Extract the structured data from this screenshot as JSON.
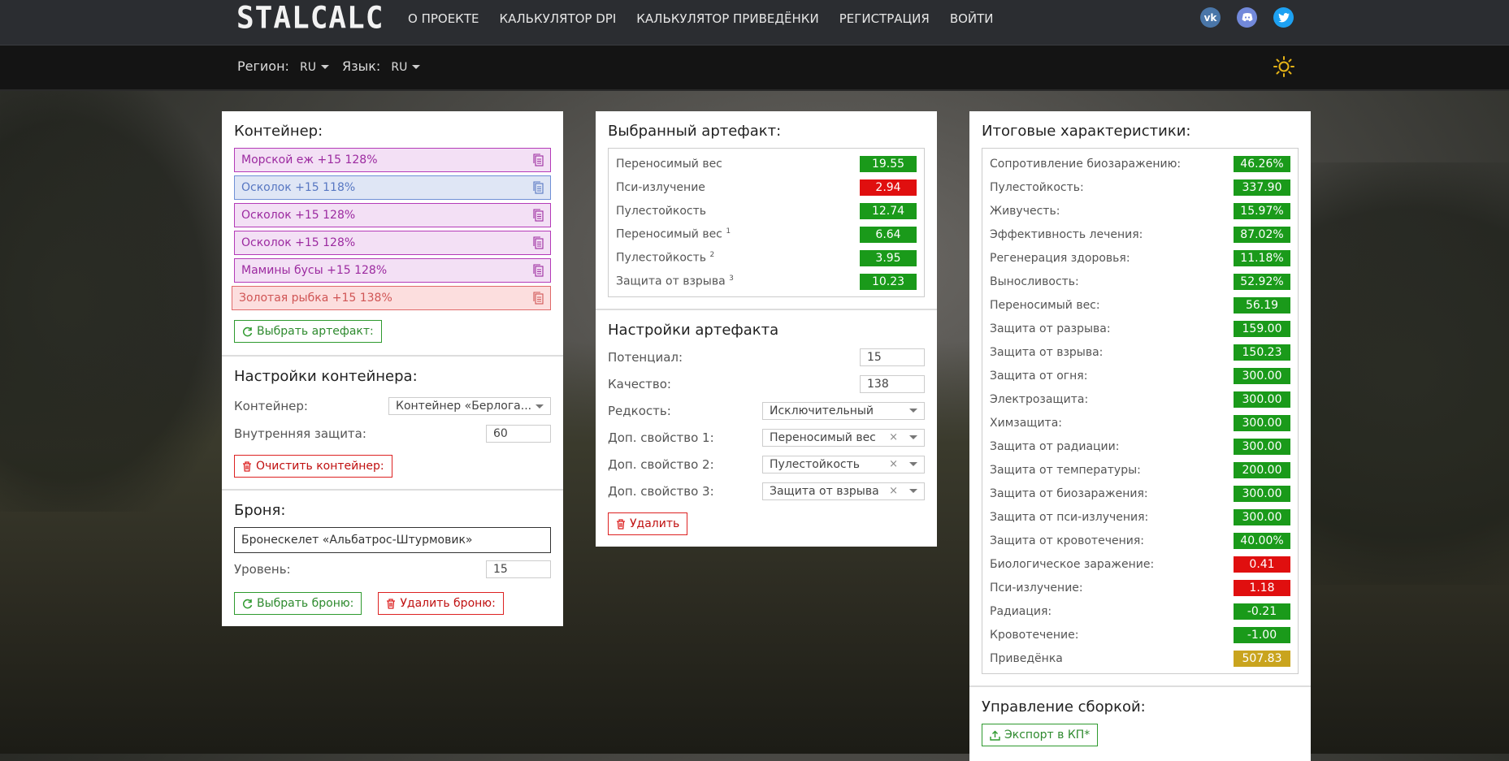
{
  "header": {
    "logo": "STALCALC",
    "nav": [
      "О ПРОЕКТЕ",
      "КАЛЬКУЛЯТОР DPI",
      "КАЛЬКУЛЯТОР ПРИВЕДЁНКИ",
      "РЕГИСТРАЦИЯ",
      "ВОЙТИ"
    ],
    "social": [
      "vk-icon",
      "discord-icon",
      "twitter-icon"
    ]
  },
  "subbar": {
    "region_label": "Регион:",
    "region_value": "RU",
    "lang_label": "Язык:",
    "lang_value": "RU",
    "theme_icon": "sun-icon"
  },
  "container_panel": {
    "title": "Контейнер:",
    "artifacts": [
      {
        "label": "Морской еж +15 128%",
        "color": "purple"
      },
      {
        "label": "Осколок +15 118%",
        "color": "blue"
      },
      {
        "label": "Осколок +15 128%",
        "color": "purple"
      },
      {
        "label": "Осколок +15 128%",
        "color": "purple"
      },
      {
        "label": "Мамины бусы +15 128%",
        "color": "purple"
      },
      {
        "label": "Золотая рыбка +15 138%",
        "color": "red"
      }
    ],
    "choose_artifact": "Выбрать артефакт:",
    "settings_title": "Настройки контейнера:",
    "container_label": "Контейнер:",
    "container_value": "Контейнер «Берлога...",
    "inner_protection_label": "Внутренняя защита:",
    "inner_protection_value": "60",
    "clear_button": "Очистить контейнер:",
    "armor_title": "Броня:",
    "armor_value": "Бронескелет «Альбатрос-Штурмовик»",
    "level_label": "Уровень:",
    "level_value": "15",
    "choose_armor": "Выбрать броню:",
    "delete_armor": "Удалить броню:"
  },
  "artifact_panel": {
    "title": "Выбранный артефакт:",
    "stats": [
      {
        "label": "Переносимый вес",
        "sup": "",
        "value": "19.55",
        "color": "g"
      },
      {
        "label": "Пси-излучение",
        "sup": "",
        "value": "2.94",
        "color": "r"
      },
      {
        "label": "Пулестойкость",
        "sup": "",
        "value": "12.74",
        "color": "g"
      },
      {
        "label": "Переносимый вес",
        "sup": "1",
        "value": "6.64",
        "color": "g"
      },
      {
        "label": "Пулестойкость",
        "sup": "2",
        "value": "3.95",
        "color": "g"
      },
      {
        "label": "Защита от взрыва",
        "sup": "3",
        "value": "10.23",
        "color": "g"
      }
    ],
    "settings_title": "Настройки артефакта",
    "potential_label": "Потенциал:",
    "potential_value": "15",
    "quality_label": "Качество:",
    "quality_value": "138",
    "rarity_label": "Редкость:",
    "rarity_value": "Исключительный",
    "prop1_label": "Доп. свойство 1:",
    "prop1_value": "Переносимый вес",
    "prop2_label": "Доп. свойство 2:",
    "prop2_value": "Пулестойкость",
    "prop3_label": "Доп. свойство 3:",
    "prop3_value": "Защита от взрыва",
    "delete_button": "Удалить"
  },
  "totals_panel": {
    "title": "Итоговые характеристики:",
    "stats": [
      {
        "label": "Сопротивление биозаражению:",
        "value": "46.26%",
        "color": "g"
      },
      {
        "label": "Пулестойкость:",
        "value": "337.90",
        "color": "g"
      },
      {
        "label": "Живучесть:",
        "value": "15.97%",
        "color": "g"
      },
      {
        "label": "Эффективность лечения:",
        "value": "87.02%",
        "color": "g"
      },
      {
        "label": "Регенерация здоровья:",
        "value": "11.18%",
        "color": "g"
      },
      {
        "label": "Выносливость:",
        "value": "52.92%",
        "color": "g"
      },
      {
        "label": "Переносимый вес:",
        "value": "56.19",
        "color": "g"
      },
      {
        "label": "Защита от разрыва:",
        "value": "159.00",
        "color": "g"
      },
      {
        "label": "Защита от взрыва:",
        "value": "150.23",
        "color": "g"
      },
      {
        "label": "Защита от огня:",
        "value": "300.00",
        "color": "g"
      },
      {
        "label": "Электрозащита:",
        "value": "300.00",
        "color": "g"
      },
      {
        "label": "Химзащита:",
        "value": "300.00",
        "color": "g"
      },
      {
        "label": "Защита от радиации:",
        "value": "300.00",
        "color": "g"
      },
      {
        "label": "Защита от температуры:",
        "value": "200.00",
        "color": "g"
      },
      {
        "label": "Защита от биозаражения:",
        "value": "300.00",
        "color": "g"
      },
      {
        "label": "Защита от пси-излучения:",
        "value": "300.00",
        "color": "g"
      },
      {
        "label": "Защита от кровотечения:",
        "value": "40.00%",
        "color": "g"
      },
      {
        "label": "Биологическое заражение:",
        "value": "0.41",
        "color": "r"
      },
      {
        "label": "Пси-излучение:",
        "value": "1.18",
        "color": "r"
      },
      {
        "label": "Радиация:",
        "value": "-0.21",
        "color": "g"
      },
      {
        "label": "Кровотечение:",
        "value": "-1.00",
        "color": "g"
      },
      {
        "label": "Приведёнка",
        "value": "507.83",
        "color": "y"
      }
    ],
    "manage_title": "Управление сборкой:",
    "export_button": "Экспорт в КП*"
  }
}
